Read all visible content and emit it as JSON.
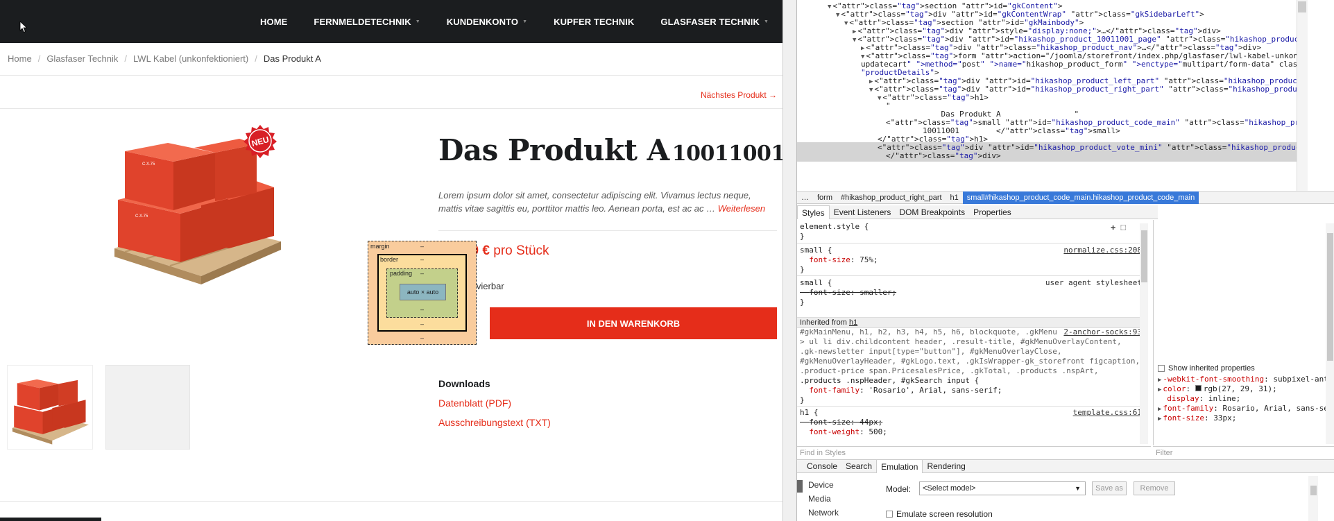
{
  "site": {
    "nav": [
      {
        "label": "HOME",
        "caret": false
      },
      {
        "label": "FERNMELDETECHNIK",
        "caret": true
      },
      {
        "label": "KUNDENKONTO",
        "caret": true
      },
      {
        "label": "KUPFER TECHNIK",
        "caret": false
      },
      {
        "label": "GLASFASER TECHNIK",
        "caret": true
      }
    ],
    "breadcrumb": {
      "items": [
        "Home",
        "Glasfaser Technik",
        "LWL Kabel (unkonfektioniert)"
      ],
      "current": "Das Produkt A",
      "separator": "/"
    },
    "next_product": "Nächstes Produkt →",
    "badge": "NEU",
    "box_label": "C.X.75",
    "product": {
      "name": "Das Produkt A",
      "code": "10011001",
      "description": "Lorem ipsum dolor sit amet, consectetur adipiscing elit. Vivamus lectus neque, mattis vitae sagittis eu, porttitor mattis leo. Aenean porta, est ac ac …",
      "read_more": "Weiterlesen",
      "price": "150,00 €",
      "price_unit": "pro Stück",
      "stock": "200 reservierbar",
      "quantity": "1",
      "add_to_cart": "IN DEN WARENKORB"
    },
    "downloads": {
      "title": "Downloads",
      "items": [
        "Datenblatt (PDF)",
        "Ausschreibungstext (TXT)"
      ]
    },
    "colors": {
      "accent": "#e52d1a",
      "dark": "#1b1d1f"
    }
  },
  "devtools": {
    "dom": [
      {
        "indent": 0,
        "tri": "▼",
        "html": "<section id=\"gkContent\">"
      },
      {
        "indent": 1,
        "tri": "▼",
        "html": "<div id=\"gkContentWrap\" class=\"gkSidebarLeft\">"
      },
      {
        "indent": 2,
        "tri": "▼",
        "html": "<section id=\"gkMainbody\">"
      },
      {
        "indent": 3,
        "tri": "▶",
        "html": "<div style=\"display:none;\">…</div>"
      },
      {
        "indent": 3,
        "tri": "▼",
        "html": "<div id=\"hikashop_product_10011001_page\" class=\"hikashop_product_page\">"
      },
      {
        "indent": 4,
        "tri": "▶",
        "html": "<div class=\"hikashop_product_nav\">…</div>"
      },
      {
        "indent": 4,
        "tri": "▼",
        "html": "<form action=\"/joomla/storefront/index.php/glasfaser/lwl-kabel-unkonfektioniert/product/"
      },
      {
        "indent": 4,
        "tri": "",
        "html": "updatecart\" method=\"post\" name=\"hikashop_product_form\" enctype=\"multipart/form-data\" class="
      },
      {
        "indent": 4,
        "tri": "",
        "html": "\"productDetails\">"
      },
      {
        "indent": 5,
        "tri": "▶",
        "html": "<div id=\"hikashop_product_left_part\" class=\"hikashop_product_left_part\">…</div>"
      },
      {
        "indent": 5,
        "tri": "▼",
        "html": "<div id=\"hikashop_product_right_part\" class=\"hikashop_product_right_part\">"
      },
      {
        "indent": 6,
        "tri": "▼",
        "html": "<h1>"
      },
      {
        "indent": 7,
        "tri": "",
        "html": "\""
      },
      {
        "indent": 7,
        "tri": "",
        "html": "            Das Produkt A                \""
      },
      {
        "indent": 7,
        "tri": "",
        "html": "<small id=\"hikashop_product_code_main\" class=\"hikashop_product_code_main\">"
      },
      {
        "indent": 7,
        "tri": "",
        "html": "        10011001        </small>"
      },
      {
        "indent": 6,
        "tri": "",
        "html": "</h1>"
      },
      {
        "indent": 6,
        "tri": "",
        "html": "<div id=\"hikashop_product_vote_mini\" class=\"hikashop_product_vote_mini\">"
      },
      {
        "indent": 7,
        "tri": "",
        "html": "</div>"
      }
    ],
    "crumbs": [
      "…",
      "form",
      "#hikashop_product_right_part",
      "h1",
      "small#hikashop_product_code_main.hikashop_product_code_main"
    ],
    "styles_tabs": [
      "Styles",
      "Event Listeners",
      "DOM Breakpoints",
      "Properties"
    ],
    "rules": {
      "element_style": "element.style {",
      "small1_selector": "small {",
      "small1_source": "normalize.css:208",
      "small1_prop": "font-size",
      "small1_val": "75%;",
      "small2_selector": "small {",
      "small2_source": "user agent stylesheet",
      "small2_prop": "font-size: smaller;",
      "inherited_label": "Inherited from",
      "inherited_tag": "h1",
      "gk_selector_1": "#gkMainMenu, h1, h2, h3, h4, h5, h6, blockquote, .gkMenu",
      "gk_source": "2-anchor-socks:93",
      "gk_selector_2": "> ul li div.childcontent header, .result-title, #gkMenuOverlayContent,",
      "gk_selector_3": ".gk-newsletter input[type=\"button\"], #gkMenuOverlayClose,",
      "gk_selector_4": "#gkMenuOverlayHeader, #gkLogo.text, .gkIsWrapper-gk_storefront figcaption,",
      "gk_selector_5": ".product-price span.PricesalesPrice, .gkTotal, .products .nspArt,",
      "gk_selector_6": ".products .nspHeader, #gkSearch input {",
      "gk_prop": "font-family",
      "gk_val": "'Rosario', Arial, sans-serif;",
      "h1_selector": "h1 {",
      "h1_source": "template.css:61",
      "h1_prop1": "font-size: 44px;",
      "h1_prop2": "font-weight",
      "h1_val2": "500;"
    },
    "find_placeholder": "Find in Styles",
    "filter_placeholder": "Filter",
    "boxmodel": {
      "margin": "margin",
      "border": "border",
      "padding": "padding",
      "content": "auto × auto",
      "dash": "–"
    },
    "computed": {
      "show_inherited": "Show inherited properties",
      "lines": [
        {
          "key": "-webkit-font-smoothing",
          "val": "subpixel-antialiased;",
          "tri": true
        },
        {
          "key": "color",
          "val": "rgb(27, 29, 31);",
          "tri": true,
          "swatch": "#1b1d1f"
        },
        {
          "key": "display",
          "val": "inline;",
          "tri": false
        },
        {
          "key": "font-family",
          "val": "Rosario, Arial, sans-serif;",
          "tri": true
        },
        {
          "key": "font-size",
          "val": "33px;",
          "tri": true
        }
      ]
    },
    "drawer_tabs": [
      "Console",
      "Search",
      "Emulation",
      "Rendering"
    ],
    "drawer_active": "Emulation",
    "emulation": {
      "side": [
        "Device",
        "Media",
        "Network"
      ],
      "model_label": "Model:",
      "model_value": "<Select model>",
      "save_as": "Save as",
      "remove": "Remove",
      "emulate_resolution": "Emulate screen resolution"
    }
  }
}
